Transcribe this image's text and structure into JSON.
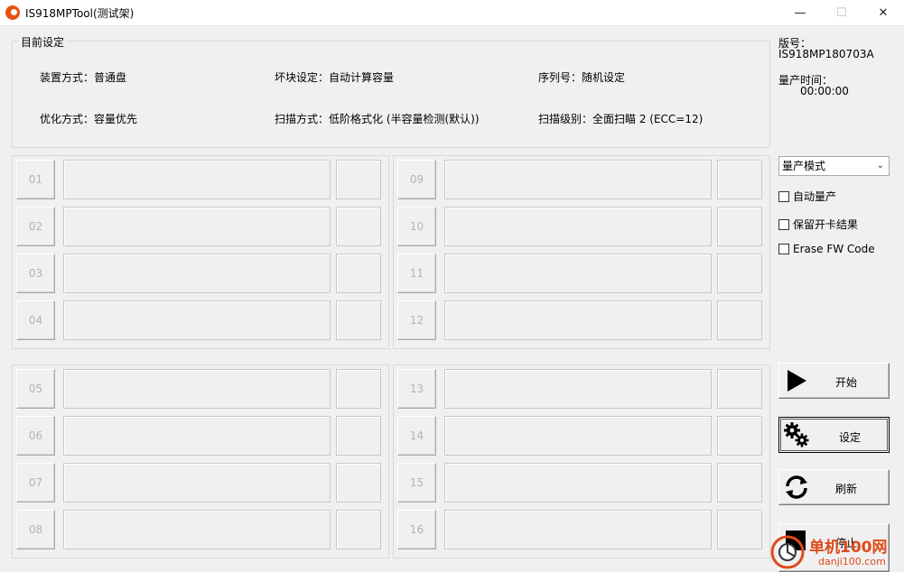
{
  "window": {
    "title": "IS918MPTool(测试架)",
    "minimize_glyph": "—",
    "maximize_glyph": "☐",
    "close_glyph": "✕"
  },
  "settings": {
    "legend": "目前设定",
    "device_mode": "装置方式：普通盘",
    "bad_block": "坏块设定：自动计算容量",
    "serial": "序列号：随机设定",
    "optimize": "优化方式：容量优先",
    "scan_mode": "扫描方式：低阶格式化 (半容量检测(默认))",
    "scan_level": "扫描级别：全面扫瞄 2 (ECC=12)"
  },
  "version": {
    "label": "版号：",
    "value": "IS918MP180703A"
  },
  "production_time": {
    "label": "量产时间：",
    "value": "00:00:00"
  },
  "mode_select": {
    "selected": "量产模式",
    "chevron_icon": "chevron-down-icon"
  },
  "options": [
    {
      "label": "自动量产",
      "checked": false
    },
    {
      "label": "保留开卡结果",
      "checked": false
    },
    {
      "label": "Erase FW Code",
      "checked": false
    }
  ],
  "buttons": {
    "start": "开始",
    "settings": "设定",
    "refresh": "刷新",
    "stop": "停止"
  },
  "icons": {
    "start": "play-icon",
    "settings": "gears-icon",
    "refresh": "refresh-icon",
    "stop": "stop-icon"
  },
  "slots": [
    "01",
    "02",
    "03",
    "04",
    "05",
    "06",
    "07",
    "08",
    "09",
    "10",
    "11",
    "12",
    "13",
    "14",
    "15",
    "16"
  ],
  "watermark": {
    "text": "单机100网",
    "sub": "danji100.com"
  }
}
